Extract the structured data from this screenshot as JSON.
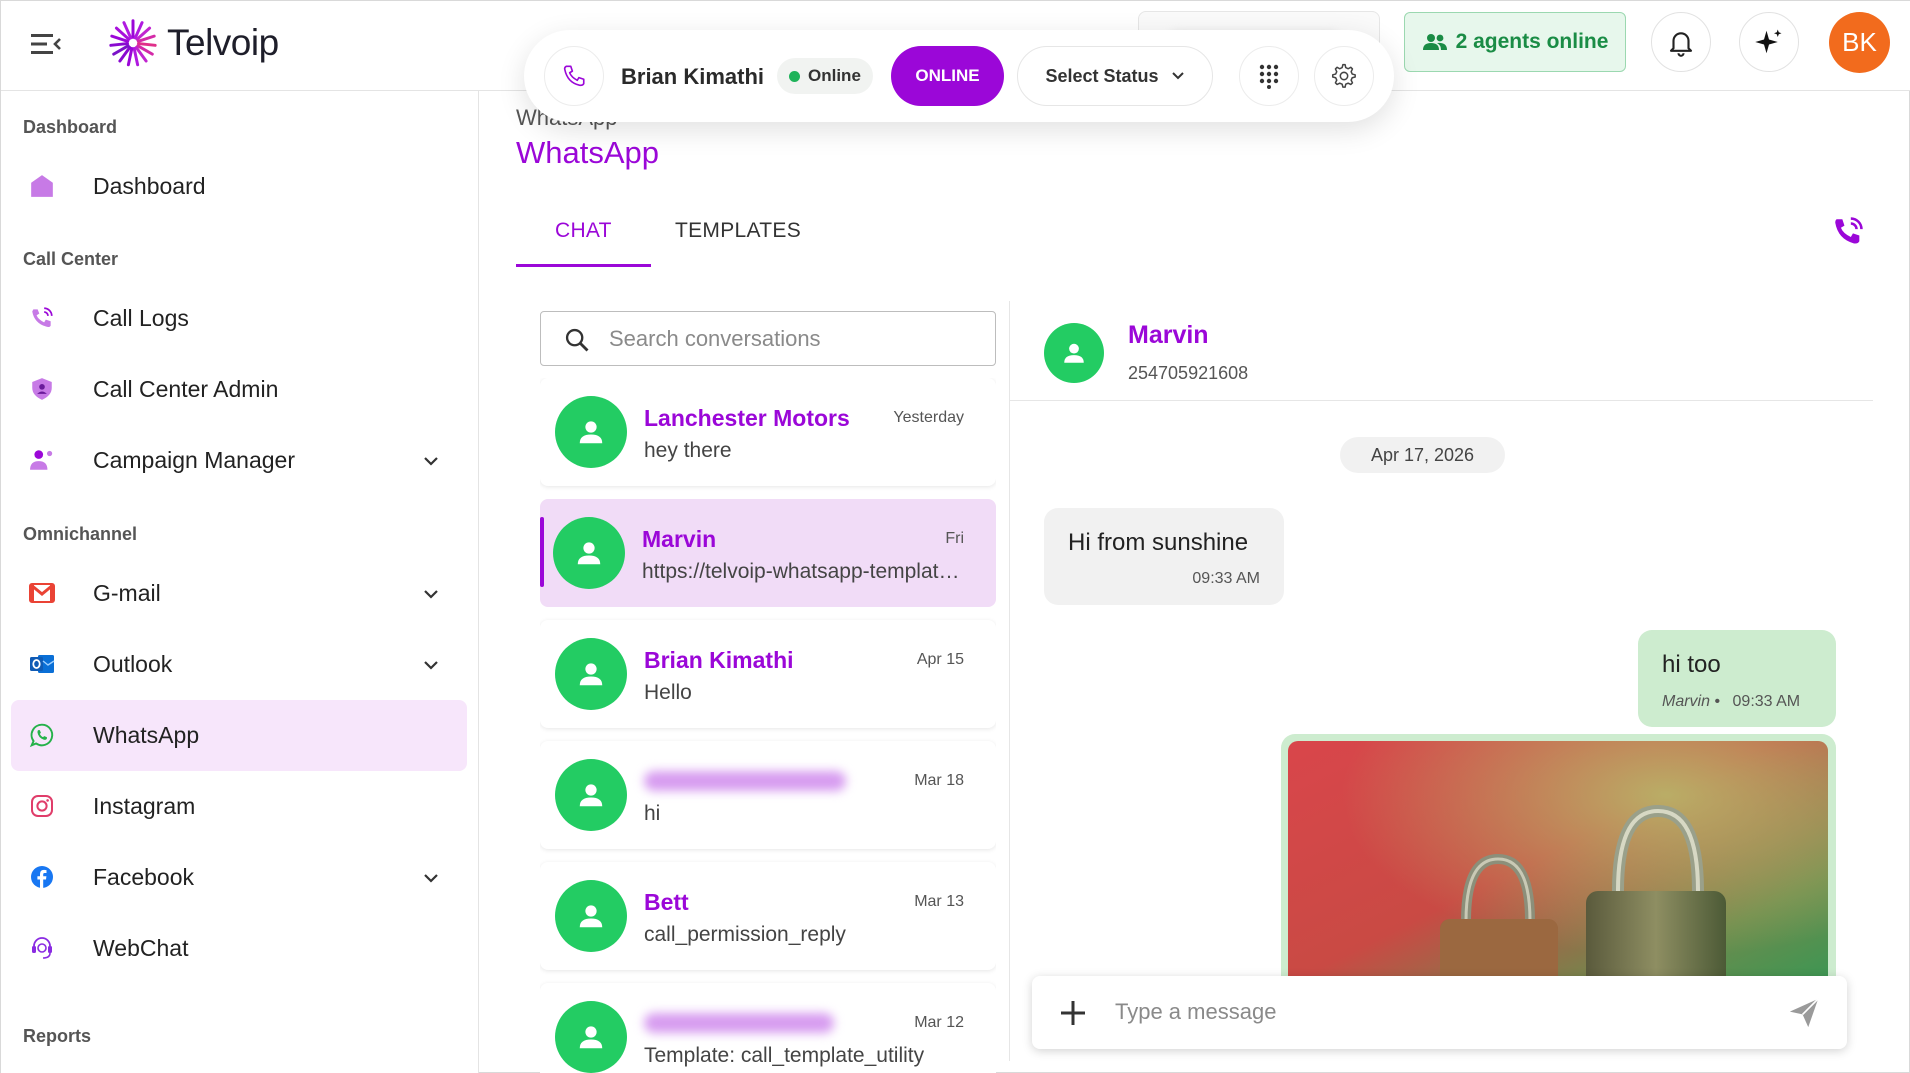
{
  "app": {
    "name": "Telvoip"
  },
  "topbar": {
    "agents_online": "2 agents online",
    "avatar_initials": "BK"
  },
  "callbar": {
    "agent_name": "Brian Kimathi",
    "presence_label": "Online",
    "online_button": "ONLINE",
    "status_select": "Select Status"
  },
  "sidebar": {
    "sections": {
      "dashboard": "Dashboard",
      "call_center": "Call Center",
      "omnichannel": "Omnichannel",
      "reports": "Reports"
    },
    "items": {
      "dashboard": "Dashboard",
      "call_logs": "Call Logs",
      "call_center_admin": "Call Center Admin",
      "campaign_manager": "Campaign Manager",
      "gmail": "G-mail",
      "outlook": "Outlook",
      "whatsapp": "WhatsApp",
      "instagram": "Instagram",
      "facebook": "Facebook",
      "webchat": "WebChat"
    }
  },
  "page": {
    "breadcrumb": "WhatsApp",
    "title": "WhatsApp",
    "tabs": [
      "CHAT",
      "TEMPLATES"
    ]
  },
  "search": {
    "placeholder": "Search conversations"
  },
  "conversations": [
    {
      "name": "Lanchester Motors",
      "time": "Yesterday",
      "preview": "hey there"
    },
    {
      "name": "Marvin",
      "time": "Fri",
      "preview": "https://telvoip-whatsapp-template-media"
    },
    {
      "name": "Brian Kimathi",
      "time": "Apr 15",
      "preview": "Hello"
    },
    {
      "name": "",
      "time": "Mar 18",
      "preview": "hi"
    },
    {
      "name": "Bett",
      "time": "Mar 13",
      "preview": "call_permission_reply"
    },
    {
      "name": "",
      "time": "Mar 12",
      "preview": "Template: call_template_utility"
    }
  ],
  "chat": {
    "contact_name": "Marvin",
    "contact_number": "254705921608",
    "date_divider": "Apr 17, 2026",
    "incoming": {
      "text": "Hi from sunshine",
      "time": "09:33 AM"
    },
    "outgoing": {
      "text": "hi too",
      "sender": "Marvin",
      "separator": "•",
      "time": "09:33 AM"
    },
    "composer_placeholder": "Type a message"
  },
  "colors": {
    "brand_purple": "#9b07d8",
    "online_green": "#1fb35a",
    "avatar_green": "#23cc63",
    "avatar_orange": "#f26b1d",
    "outgoing_bubble": "#cdeccf",
    "active_nav": "#f7e6fb"
  },
  "icons": {
    "menu": "menu-collapse-icon",
    "bell": "bell-icon",
    "ai": "sparkle-icon",
    "dialpad": "dialpad-icon",
    "settings": "gear-icon",
    "search": "search-icon",
    "attach": "plus-icon",
    "send": "send-icon"
  }
}
